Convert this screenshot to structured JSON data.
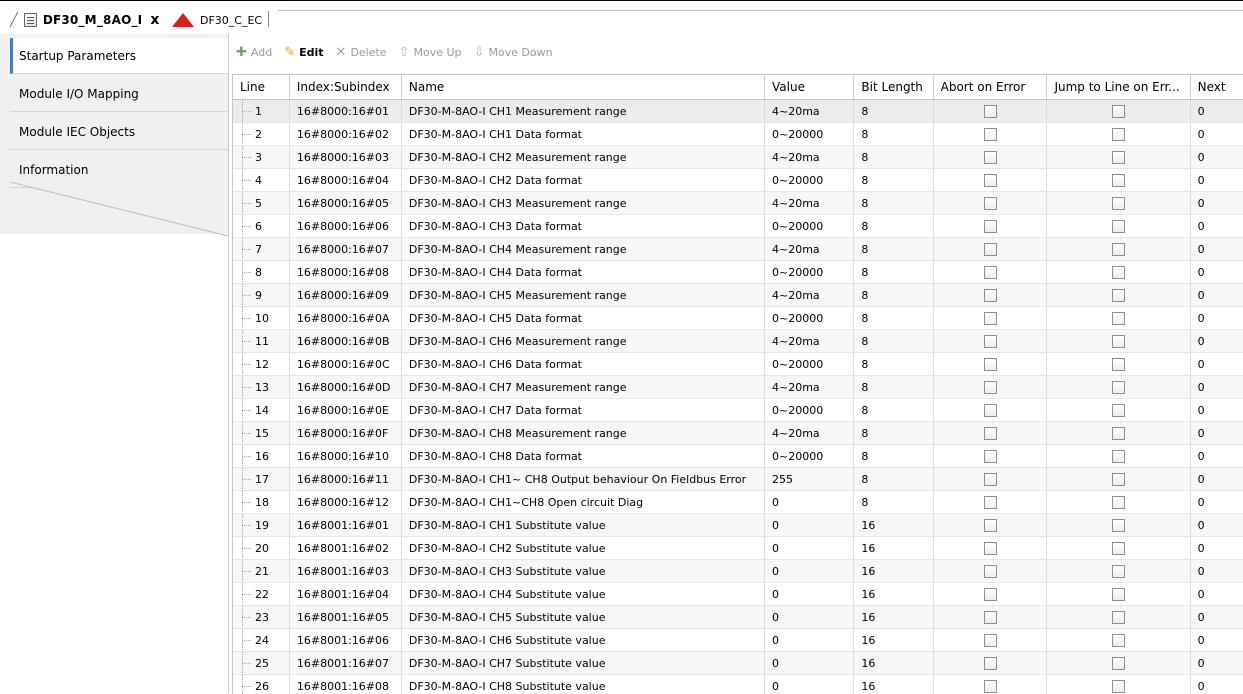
{
  "tabs": [
    {
      "title": "DF30_M_8AO_I",
      "close": "x"
    },
    {
      "title": "DF30_C_EC"
    }
  ],
  "sidebar": {
    "items": [
      {
        "label": "Startup Parameters",
        "active": true
      },
      {
        "label": "Module I/O Mapping"
      },
      {
        "label": "Module IEC Objects"
      },
      {
        "label": "Information"
      }
    ]
  },
  "toolbar": {
    "add": "Add",
    "edit": "Edit",
    "delete": "Delete",
    "move_up": "Move Up",
    "move_down": "Move Down"
  },
  "table": {
    "headers": [
      "Line",
      "Index:Subindex",
      "Name",
      "Value",
      "Bit Length",
      "Abort on Error",
      "Jump to Line on Err...",
      "Next"
    ],
    "rows": [
      {
        "line": "1",
        "index": "16#8000:16#01",
        "name": "DF30-M-8AO-I CH1 Measurement range",
        "value": "4~20ma",
        "bits": "8",
        "next": "0"
      },
      {
        "line": "2",
        "index": "16#8000:16#02",
        "name": "DF30-M-8AO-I CH1 Data format",
        "value": "0~20000",
        "bits": "8",
        "next": "0"
      },
      {
        "line": "3",
        "index": "16#8000:16#03",
        "name": "DF30-M-8AO-I CH2 Measurement range",
        "value": "4~20ma",
        "bits": "8",
        "next": "0"
      },
      {
        "line": "4",
        "index": "16#8000:16#04",
        "name": "DF30-M-8AO-I CH2 Data format",
        "value": "0~20000",
        "bits": "8",
        "next": "0"
      },
      {
        "line": "5",
        "index": "16#8000:16#05",
        "name": "DF30-M-8AO-I CH3 Measurement range",
        "value": "4~20ma",
        "bits": "8",
        "next": "0"
      },
      {
        "line": "6",
        "index": "16#8000:16#06",
        "name": "DF30-M-8AO-I CH3 Data format",
        "value": "0~20000",
        "bits": "8",
        "next": "0"
      },
      {
        "line": "7",
        "index": "16#8000:16#07",
        "name": "DF30-M-8AO-I CH4 Measurement range",
        "value": "4~20ma",
        "bits": "8",
        "next": "0"
      },
      {
        "line": "8",
        "index": "16#8000:16#08",
        "name": "DF30-M-8AO-I CH4 Data format",
        "value": "0~20000",
        "bits": "8",
        "next": "0"
      },
      {
        "line": "9",
        "index": "16#8000:16#09",
        "name": "DF30-M-8AO-I CH5 Measurement range",
        "value": "4~20ma",
        "bits": "8",
        "next": "0"
      },
      {
        "line": "10",
        "index": "16#8000:16#0A",
        "name": "DF30-M-8AO-I CH5 Data format",
        "value": "0~20000",
        "bits": "8",
        "next": "0"
      },
      {
        "line": "11",
        "index": "16#8000:16#0B",
        "name": "DF30-M-8AO-I CH6 Measurement range",
        "value": "4~20ma",
        "bits": "8",
        "next": "0"
      },
      {
        "line": "12",
        "index": "16#8000:16#0C",
        "name": "DF30-M-8AO-I CH6 Data format",
        "value": "0~20000",
        "bits": "8",
        "next": "0"
      },
      {
        "line": "13",
        "index": "16#8000:16#0D",
        "name": "DF30-M-8AO-I CH7 Measurement range",
        "value": "4~20ma",
        "bits": "8",
        "next": "0"
      },
      {
        "line": "14",
        "index": "16#8000:16#0E",
        "name": "DF30-M-8AO-I CH7 Data format",
        "value": "0~20000",
        "bits": "8",
        "next": "0"
      },
      {
        "line": "15",
        "index": "16#8000:16#0F",
        "name": "DF30-M-8AO-I CH8 Measurement range",
        "value": "4~20ma",
        "bits": "8",
        "next": "0"
      },
      {
        "line": "16",
        "index": "16#8000:16#10",
        "name": "DF30-M-8AO-I CH8 Data format",
        "value": "0~20000",
        "bits": "8",
        "next": "0"
      },
      {
        "line": "17",
        "index": "16#8000:16#11",
        "name": "DF30-M-8AO-I CH1~ CH8 Output behaviour On Fieldbus Error",
        "value": "255",
        "bits": "8",
        "next": "0"
      },
      {
        "line": "18",
        "index": "16#8000:16#12",
        "name": "DF30-M-8AO-I CH1~CH8 Open circuit Diag",
        "value": "0",
        "bits": "8",
        "next": "0"
      },
      {
        "line": "19",
        "index": "16#8001:16#01",
        "name": "DF30-M-8AO-I CH1 Substitute value",
        "value": "0",
        "bits": "16",
        "next": "0"
      },
      {
        "line": "20",
        "index": "16#8001:16#02",
        "name": "DF30-M-8AO-I CH2 Substitute value",
        "value": "0",
        "bits": "16",
        "next": "0"
      },
      {
        "line": "21",
        "index": "16#8001:16#03",
        "name": "DF30-M-8AO-I CH3 Substitute value",
        "value": "0",
        "bits": "16",
        "next": "0"
      },
      {
        "line": "22",
        "index": "16#8001:16#04",
        "name": "DF30-M-8AO-I CH4 Substitute value",
        "value": "0",
        "bits": "16",
        "next": "0"
      },
      {
        "line": "23",
        "index": "16#8001:16#05",
        "name": "DF30-M-8AO-I CH5 Substitute value",
        "value": "0",
        "bits": "16",
        "next": "0"
      },
      {
        "line": "24",
        "index": "16#8001:16#06",
        "name": "DF30-M-8AO-I CH6 Substitute value",
        "value": "0",
        "bits": "16",
        "next": "0"
      },
      {
        "line": "25",
        "index": "16#8001:16#07",
        "name": "DF30-M-8AO-I CH7 Substitute value",
        "value": "0",
        "bits": "16",
        "next": "0"
      },
      {
        "line": "26",
        "index": "16#8001:16#08",
        "name": "DF30-M-8AO-I CH8 Substitute value",
        "value": "0",
        "bits": "16",
        "next": "0"
      }
    ]
  }
}
